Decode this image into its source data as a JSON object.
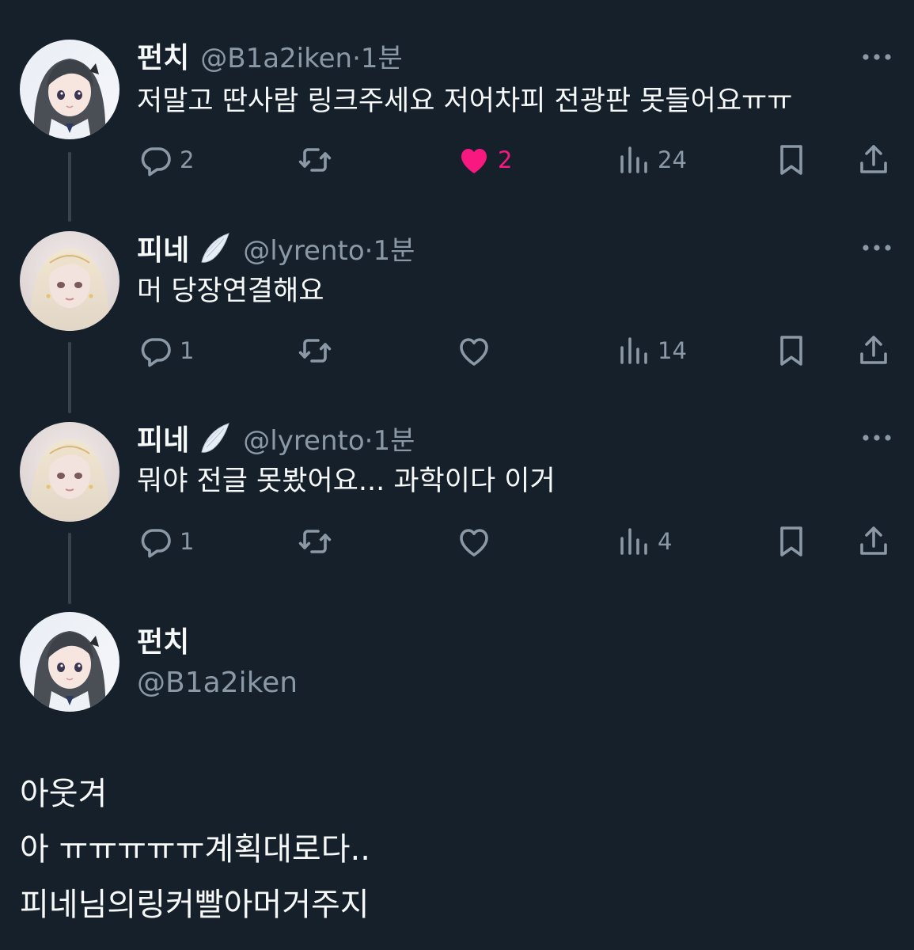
{
  "replies": [
    {
      "name": "펀치",
      "handle": "@B1a2iken",
      "time": "1분",
      "avatar": "dark-hair-girl-avatar",
      "verified_badge": false,
      "text": "저말고 딴사람 링크주세요 저어차피 전광판 못들어요ㅠㅠ",
      "stats": {
        "replies": "2",
        "retweets": "",
        "likes": "2",
        "views": "24"
      },
      "liked": true
    },
    {
      "name": "피네",
      "handle": "@lyrento",
      "time": "1분",
      "avatar": "blonde-girl-avatar",
      "verified_badge": true,
      "text": "머 당장연결해요",
      "stats": {
        "replies": "1",
        "retweets": "",
        "likes": "",
        "views": "14"
      },
      "liked": false
    },
    {
      "name": "피네",
      "handle": "@lyrento",
      "time": "1분",
      "avatar": "blonde-girl-avatar",
      "verified_badge": true,
      "text": "뭐야 전글 못봤어요... 과학이다 이거",
      "stats": {
        "replies": "1",
        "retweets": "",
        "likes": "",
        "views": "4"
      },
      "liked": false
    }
  ],
  "separator": "·",
  "main_tweet": {
    "name": "펀치",
    "handle": "@B1a2iken",
    "lines": [
      "아웃겨",
      "아 ㅠㅠㅠㅠㅠ계획대로다..",
      "피네님의링커빨아머거주지"
    ]
  },
  "colors": {
    "background": "#15202b",
    "text": "#f7f9f9",
    "secondary": "#8b98a5",
    "like": "#f91880",
    "thread_line": "#38444d"
  },
  "icons": [
    "reply-icon",
    "retweet-icon",
    "like-icon",
    "views-icon",
    "bookmark-icon",
    "share-icon",
    "more-icon",
    "wing-badge-icon"
  ]
}
